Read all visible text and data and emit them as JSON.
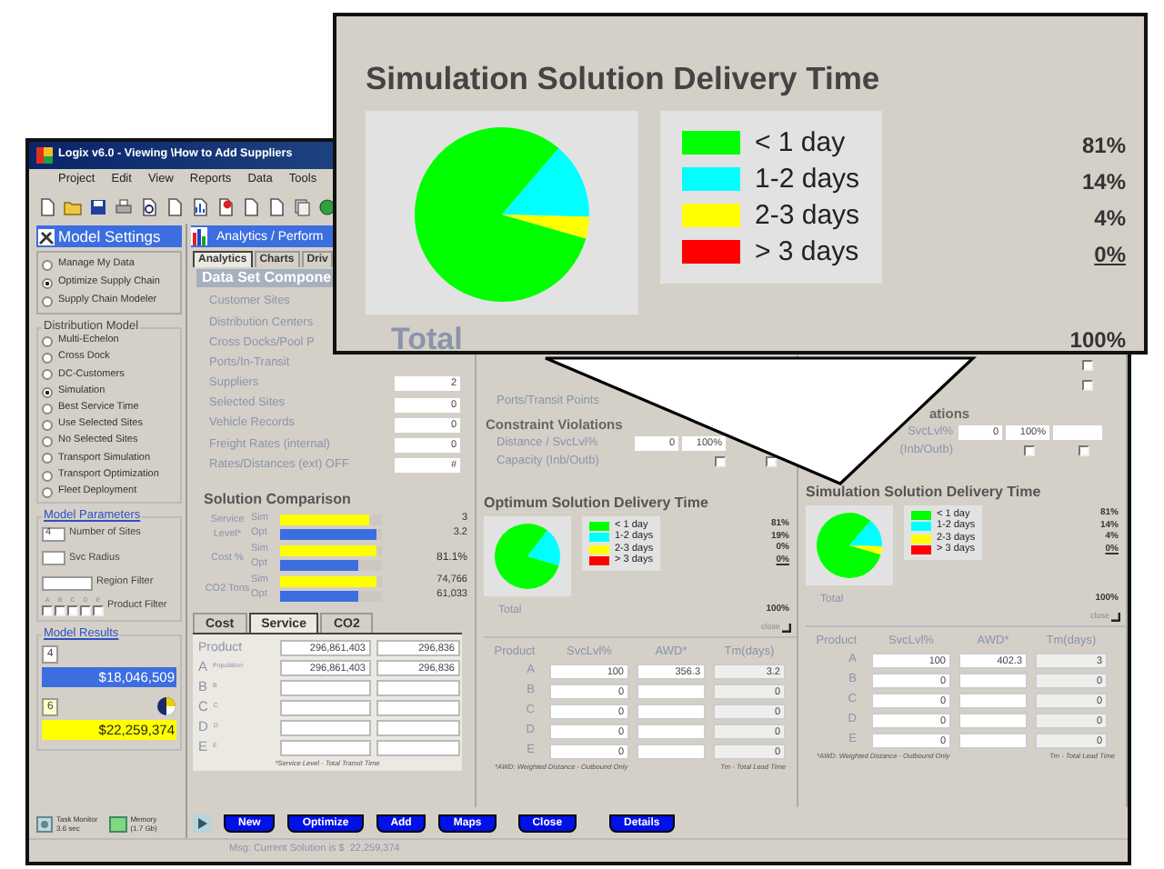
{
  "window": {
    "title": "Logix v6.0 - Viewing \\How to Add Suppliers"
  },
  "menu": [
    "Project",
    "Edit",
    "View",
    "Reports",
    "Data",
    "Tools"
  ],
  "sidebar": {
    "title": "Model Settings",
    "modes": [
      {
        "label": "Manage My Data",
        "selected": false
      },
      {
        "label": "Optimize Supply Chain",
        "selected": true
      },
      {
        "label": "Supply Chain Modeler",
        "selected": false
      }
    ],
    "distribution_model": {
      "title": "Distribution Model",
      "options": [
        {
          "label": "Multi-Echelon",
          "selected": false
        },
        {
          "label": "Cross Dock",
          "selected": false
        },
        {
          "label": "DC-Customers",
          "selected": false
        },
        {
          "label": "Simulation",
          "selected": true
        },
        {
          "label": "Best Service Time",
          "selected": false
        },
        {
          "label": "Use Selected Sites",
          "selected": false
        },
        {
          "label": "No Selected Sites",
          "selected": false
        },
        {
          "label": "Transport Simulation",
          "selected": false
        },
        {
          "label": "Transport Optimization",
          "selected": false
        },
        {
          "label": "Fleet Deployment",
          "selected": false
        }
      ]
    },
    "model_parameters": {
      "title": "Model Parameters",
      "fields": [
        {
          "value": "4",
          "label": "Number of Sites"
        },
        {
          "label": "Svc Radius"
        },
        {
          "label": "Region Filter"
        }
      ],
      "product_filter": {
        "label": "Product Filter",
        "checks": [
          {
            "letter": "A",
            "checked": false
          },
          {
            "letter": "B",
            "checked": false
          },
          {
            "letter": "C",
            "checked": false
          },
          {
            "letter": "D",
            "checked": false
          },
          {
            "letter": "E",
            "checked": false
          }
        ]
      }
    },
    "model_results": {
      "title": "Model Results",
      "results": [
        {
          "badge": "4",
          "value": "$18,046,509",
          "color": "#3c6ee0"
        },
        {
          "badge": "6",
          "value": "$22,259,374",
          "color": "#ffff00"
        }
      ]
    },
    "task_monitor": {
      "label": "Task Monitor",
      "time": "3.6 sec"
    },
    "memory": {
      "label": "Memory",
      "value": "(1.7 Gb)"
    }
  },
  "analytics": {
    "title": "Analytics / Perform",
    "tabs": [
      {
        "label": "Analytics",
        "selected": true
      },
      {
        "label": "Charts",
        "selected": false
      },
      {
        "label": "Driv",
        "selected": false
      }
    ],
    "data_set": {
      "title": "Data Set Compone",
      "rows": [
        {
          "label": "Customer Sites"
        },
        {
          "label": "Distribution Centers"
        },
        {
          "label": "Cross Docks/Pool P"
        },
        {
          "label": "Ports/In-Transit"
        },
        {
          "label": "Suppliers",
          "value": "2"
        },
        {
          "label": "Selected Sites",
          "value": "0"
        },
        {
          "label": "Vehicle Records",
          "value": "0"
        },
        {
          "label": "Freight Rates (internal)",
          "value": "0"
        },
        {
          "label": "Rates/Distances (ext) OFF",
          "value": "#"
        }
      ]
    },
    "solution_comparison": {
      "title": "Solution Comparison",
      "groups": [
        {
          "label": "Service Level*",
          "bars": [
            {
              "name": "Sim",
              "level": 0.87,
              "color": "#ffff00",
              "reading": "3"
            },
            {
              "name": "Opt",
              "level": 0.94,
              "color": "#3c6ee0",
              "reading": "3.2"
            }
          ]
        },
        {
          "label": "Cost %",
          "reading": "81.1%",
          "bars": [
            {
              "name": "Sim",
              "level": 0.94,
              "color": "#ffff00"
            },
            {
              "name": "Opt",
              "level": 0.76,
              "color": "#3c6ee0"
            }
          ]
        },
        {
          "label": "CO2 Tons",
          "bars": [
            {
              "name": "Sim",
              "level": 0.94,
              "color": "#ffff00",
              "reading": "74,766"
            },
            {
              "name": "Opt",
              "level": 0.76,
              "color": "#3c6ee0",
              "reading": "61,033"
            }
          ]
        }
      ]
    },
    "product_tabs": [
      {
        "label": "Cost",
        "selected": false
      },
      {
        "label": "Service",
        "selected": true
      },
      {
        "label": "CO2",
        "selected": false
      }
    ],
    "product_table": {
      "header": {
        "label": "Product",
        "values": [
          "296,861,403",
          "296,836"
        ]
      },
      "rows": [
        {
          "letter": "A",
          "name": "Population",
          "values": [
            "296,861,403",
            "296,836"
          ]
        },
        {
          "letter": "B",
          "name": "B"
        },
        {
          "letter": "C",
          "name": "C"
        },
        {
          "letter": "D",
          "name": "D"
        },
        {
          "letter": "E",
          "name": "E"
        }
      ],
      "footnote": "*Service Level - Total Transit Time"
    }
  },
  "panels": [
    {
      "top_labels": [
        "Ports/Transit Points"
      ],
      "constraints": {
        "title": "Constraint Violations",
        "distance_label": "Distance / SvcLvl%",
        "distance_fields": [
          {
            "kind": "value",
            "value": "0"
          },
          {
            "kind": "value",
            "value": "100%"
          }
        ],
        "capacity_label": "Capacity (Inb/Outb)",
        "capacity_checks": [
          {
            "checked": false
          },
          {
            "checked": false
          }
        ]
      },
      "delivery": {
        "title": "Optimum Solution Delivery Time",
        "chart_data": {
          "type": "pie",
          "categories": [
            "< 1 day",
            "1-2 days",
            "2-3 days",
            "> 3 days"
          ],
          "values": [
            81,
            19,
            0,
            0
          ]
        },
        "legend": [
          {
            "color": "#00ff00",
            "percent": "81%",
            "underlined": false
          },
          {
            "color": "#00ffff",
            "percent": "19%",
            "underlined": false
          },
          {
            "color": "#ffff00",
            "percent": "0%",
            "underlined": false
          },
          {
            "color": "#ff0000",
            "percent": "0%",
            "underlined": true
          }
        ],
        "total_label": "Total",
        "total": "100%",
        "close": "close"
      },
      "table": {
        "columns": [
          "Product",
          "SvcLvl%",
          "AWD*",
          "Tm(days)"
        ],
        "rows": [
          {
            "product": "A",
            "svc": "100",
            "awd": "356.3",
            "tm": "3.2"
          },
          {
            "product": "B",
            "svc": "0",
            "tm": "0"
          },
          {
            "product": "C",
            "svc": "0",
            "tm": "0"
          },
          {
            "product": "D",
            "svc": "0",
            "tm": "0"
          },
          {
            "product": "E",
            "svc": "0",
            "tm": "0"
          }
        ],
        "footnotes": [
          "*AWD: Weighted Distance - Outbound Only",
          "Tm - Total Lead Time"
        ]
      }
    },
    {
      "top_checks": [
        {
          "checked": false
        },
        {
          "checked": false
        }
      ],
      "constraints": {
        "title": "ations",
        "distance_label": "SvcLvl%",
        "distance_fields": [
          {
            "kind": "value",
            "value": "0"
          },
          {
            "kind": "value",
            "value": "100%"
          },
          {
            "kind": "blank"
          }
        ],
        "capacity_label": "(Inb/Outb)",
        "capacity_checks": [
          {
            "checked": false
          },
          {
            "checked": false
          }
        ]
      },
      "delivery": {
        "title": "Simulation Solution Delivery Time",
        "chart_data": {
          "type": "pie",
          "categories": [
            "< 1 day",
            "1-2 days",
            "2-3 days",
            "> 3 days"
          ],
          "values": [
            81,
            14,
            4,
            0
          ]
        },
        "legend": [
          {
            "color": "#00ff00",
            "percent": "81%",
            "underlined": false
          },
          {
            "color": "#00ffff",
            "percent": "14%",
            "underlined": false
          },
          {
            "color": "#ffff00",
            "percent": "4%",
            "underlined": false
          },
          {
            "color": "#ff0000",
            "percent": "0%",
            "underlined": true
          }
        ],
        "total_label": "Total",
        "total": "100%",
        "close": "close"
      },
      "table": {
        "columns": [
          "Product",
          "SvcLvl%",
          "AWD*",
          "Tm(days)"
        ],
        "rows": [
          {
            "product": "A",
            "svc": "100",
            "awd": "402.3",
            "tm": "3"
          },
          {
            "product": "B",
            "svc": "0",
            "tm": "0"
          },
          {
            "product": "C",
            "svc": "0",
            "tm": "0"
          },
          {
            "product": "D",
            "svc": "0",
            "tm": "0"
          },
          {
            "product": "E",
            "svc": "0",
            "tm": "0"
          }
        ],
        "footnotes": [
          "*AWD: Weighted Distance - Outbound Only",
          "Tm - Total Lead Time"
        ]
      }
    }
  ],
  "buttons": [
    "New",
    "Optimize",
    "Add",
    "Maps",
    "Close",
    "Details"
  ],
  "status": "Msg: Current Solution is $  22,259,374",
  "callout": {
    "title": "Simulation Solution Delivery Time",
    "chart_data": {
      "type": "pie",
      "categories": [
        "< 1 day",
        "1-2 days",
        "2-3 days",
        "> 3 days"
      ],
      "values": [
        81,
        14,
        4,
        0
      ]
    },
    "legend": [
      {
        "color": "#00ff00",
        "percent": "81%",
        "underlined": false
      },
      {
        "color": "#00ffff",
        "percent": "14%",
        "underlined": false
      },
      {
        "color": "#ffff00",
        "percent": "4%",
        "underlined": false
      },
      {
        "color": "#ff0000",
        "percent": "0%",
        "underlined": true
      }
    ],
    "total_label": "Total",
    "total": "100%"
  }
}
